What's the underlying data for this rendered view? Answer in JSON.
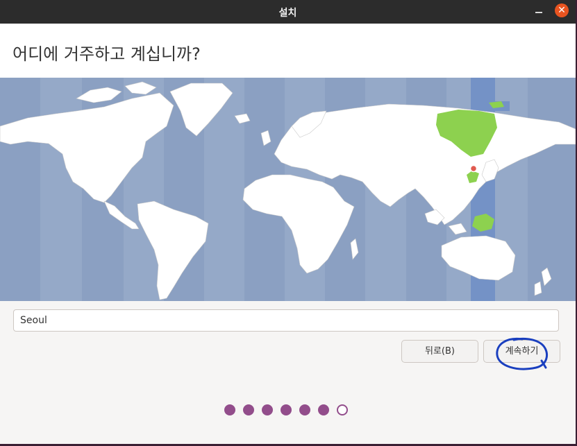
{
  "window": {
    "title": "설치"
  },
  "page": {
    "heading": "어디에 거주하고 계십니까?"
  },
  "map": {
    "selected_city": "Seoul",
    "colors": {
      "ocean": "#95a9c8",
      "land": "#ffffff",
      "zone_band": "#7492c6",
      "highlight": "#8dd14f",
      "pin": "#e05a4f"
    }
  },
  "timezone": {
    "value": "Seoul"
  },
  "buttons": {
    "back_label": "뒤로(B)",
    "continue_label": "계속하기"
  },
  "progress": {
    "total_steps": 7,
    "completed_steps": 6
  },
  "colors": {
    "accent": "#924d8b",
    "close": "#e95420"
  }
}
